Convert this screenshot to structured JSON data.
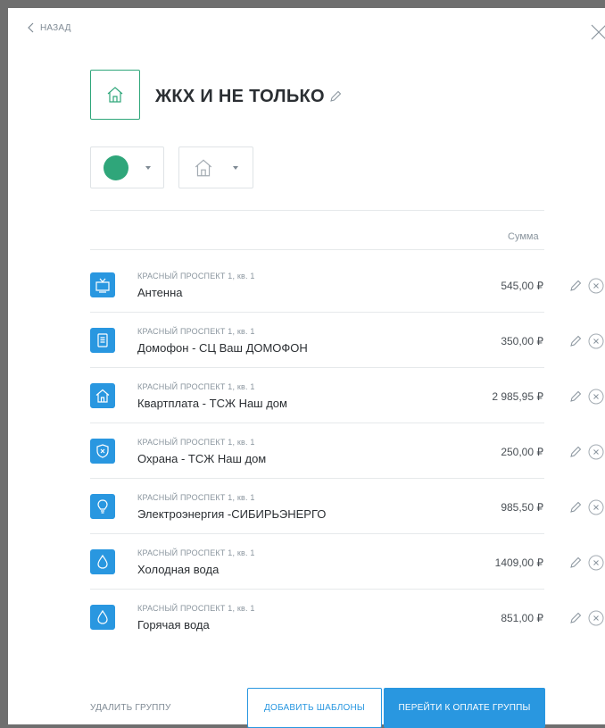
{
  "header": {
    "back_label": "НАЗАД"
  },
  "group": {
    "title": "ЖКХ И НЕ ТОЛЬКО",
    "color": "#2fa67a",
    "icon": "house-icon"
  },
  "table": {
    "sum_header": "Сумма"
  },
  "payments": [
    {
      "address": "КРАСНЫЙ ПРОСПЕКТ 1, кв. 1",
      "name": "Антенна",
      "amount": "545,00 ₽",
      "icon": "tv-icon"
    },
    {
      "address": "КРАСНЫЙ ПРОСПЕКТ 1, кв. 1",
      "name": "Домофон - СЦ Ваш ДОМОФОН",
      "amount": "350,00 ₽",
      "icon": "intercom-icon"
    },
    {
      "address": "КРАСНЫЙ ПРОСПЕКТ 1, кв. 1",
      "name": "Квартплата - ТСЖ Наш дом",
      "amount": "2 985,95 ₽",
      "icon": "house-icon"
    },
    {
      "address": "КРАСНЫЙ ПРОСПЕКТ 1, кв. 1",
      "name": "Охрана - ТСЖ Наш дом",
      "amount": "250,00 ₽",
      "icon": "shield-icon"
    },
    {
      "address": "КРАСНЫЙ ПРОСПЕКТ 1, кв. 1",
      "name": "Электроэнергия -СИБИРЬЭНЕРГО",
      "amount": "985,50 ₽",
      "icon": "bulb-icon"
    },
    {
      "address": "КРАСНЫЙ ПРОСПЕКТ 1, кв. 1",
      "name": "Холодная вода",
      "amount": "1409,00 ₽",
      "icon": "water-drop-icon"
    },
    {
      "address": "КРАСНЫЙ ПРОСПЕКТ 1, кв. 1",
      "name": "Горячая вода",
      "amount": "851,00 ₽",
      "icon": "water-drop-icon"
    }
  ],
  "actions": {
    "delete_group": "УДАЛИТЬ ГРУППУ",
    "add_templates": "ДОБАВИТЬ ШАБЛОНЫ",
    "pay_group": "ПЕРЕЙТИ К ОПЛАТЕ ГРУППЫ"
  },
  "colors": {
    "accent_blue": "#2997e0",
    "group_green": "#2fa67a"
  }
}
